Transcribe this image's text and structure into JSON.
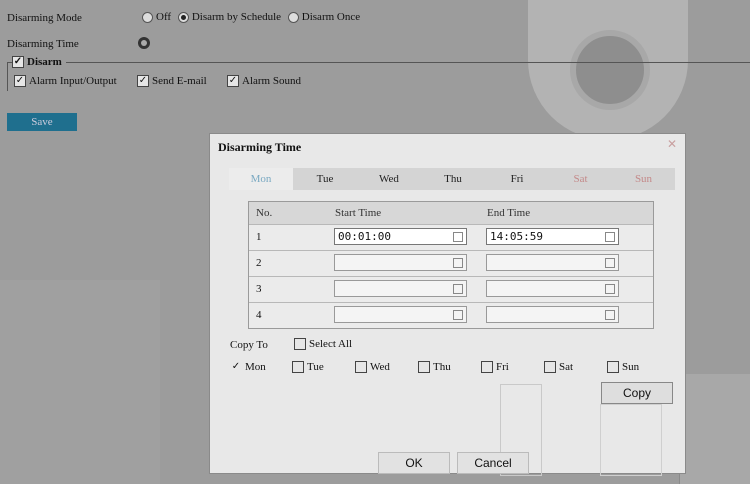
{
  "form": {
    "disarming_mode_label": "Disarming Mode",
    "mode_options": [
      {
        "label": "Off",
        "selected": false
      },
      {
        "label": "Disarm by Schedule",
        "selected": true
      },
      {
        "label": "Disarm Once",
        "selected": false
      }
    ],
    "disarming_time_label": "Disarming Time",
    "disarm_group_label": "Disarm",
    "options": [
      {
        "label": "Alarm Input/Output",
        "checked": true
      },
      {
        "label": "Send E-mail",
        "checked": true
      },
      {
        "label": "Alarm Sound",
        "checked": true
      }
    ],
    "save_label": "Save",
    "check_mark": "✓"
  },
  "dialog": {
    "title": "Disarming Time",
    "close_glyph": "✕",
    "days": [
      "Mon",
      "Tue",
      "Wed",
      "Thu",
      "Fri",
      "Sat",
      "Sun"
    ],
    "active_day": "Mon",
    "table": {
      "headers": [
        "No.",
        "Start Time",
        "End Time"
      ],
      "rows": [
        {
          "no": "1",
          "start": "00:01:00",
          "end": "14:05:59"
        },
        {
          "no": "2",
          "start": "",
          "end": ""
        },
        {
          "no": "3",
          "start": "",
          "end": ""
        },
        {
          "no": "4",
          "start": "",
          "end": ""
        }
      ]
    },
    "copy_to_label": "Copy To",
    "select_all_label": "Select All",
    "copy_days": [
      {
        "label": "Mon",
        "checked": true
      },
      {
        "label": "Tue",
        "checked": false
      },
      {
        "label": "Wed",
        "checked": false
      },
      {
        "label": "Thu",
        "checked": false
      },
      {
        "label": "Fri",
        "checked": false
      },
      {
        "label": "Sat",
        "checked": false
      },
      {
        "label": "Sun",
        "checked": false
      }
    ],
    "copy_label": "Copy",
    "ok_label": "OK",
    "cancel_label": "Cancel"
  }
}
